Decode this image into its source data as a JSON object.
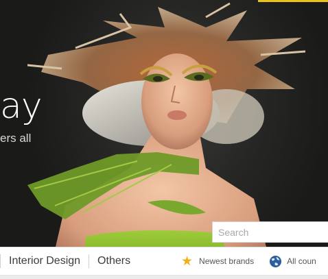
{
  "hero": {
    "title": "ay",
    "subtitle": "ers all"
  },
  "search": {
    "placeholder": "Search"
  },
  "nav": {
    "items": [
      {
        "label": "Interior Design"
      },
      {
        "label": "Others"
      }
    ],
    "newest_brands": {
      "label": "Newest brands",
      "icon": "star-icon"
    },
    "all_countries": {
      "label": "All coun",
      "icon": "globe-icon"
    }
  },
  "colors": {
    "accent": "#e8c21a",
    "star": "#f0b018",
    "globe": "#2e5e9c",
    "nav_text": "#3c3c3c"
  }
}
